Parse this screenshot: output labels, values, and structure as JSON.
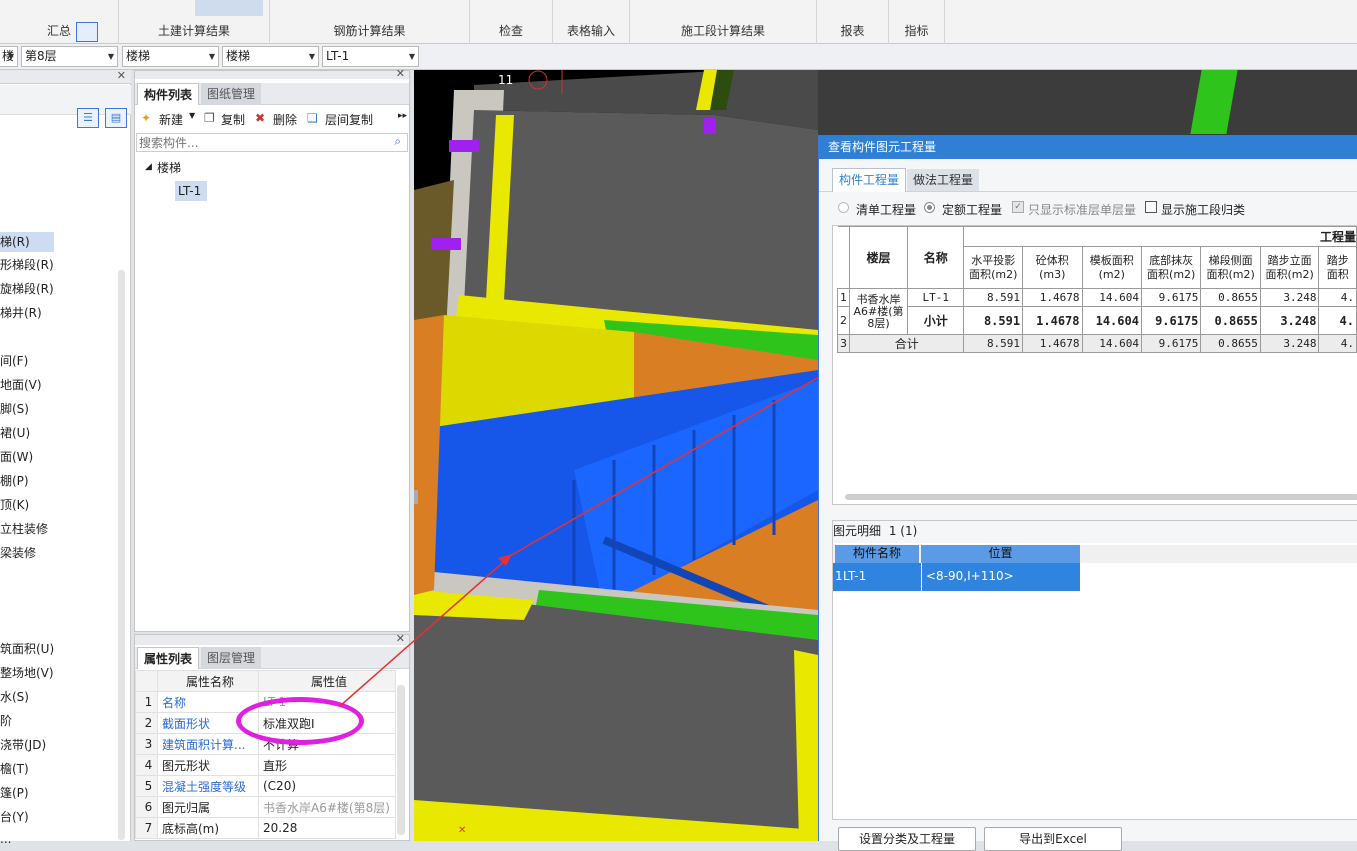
{
  "ribbon": {
    "sections": [
      "汇总",
      "土建计算结果",
      "钢筋计算结果",
      "检查",
      "表格输入",
      "施工段计算结果",
      "报表",
      "指标"
    ]
  },
  "selectors": {
    "building": "楼",
    "floor": "第8层",
    "type": "楼梯",
    "subtype": "楼梯",
    "component": "LT-1"
  },
  "leftnav": {
    "items": [
      "梯(R)",
      "形梯段(R)",
      "旋梯段(R)",
      "梯井(R)",
      "间(F)",
      "地面(V)",
      "脚(S)",
      "裙(U)",
      "面(W)",
      "棚(P)",
      "顶(K)",
      "立柱装修",
      "梁装修",
      "筑面积(U)",
      "整场地(V)",
      "水(S)",
      "阶",
      "浇带(JD)",
      "檐(T)",
      "篷(P)",
      "台(Y)",
      "..."
    ]
  },
  "complist": {
    "tabs": [
      "构件列表",
      "图纸管理"
    ],
    "toolbar": {
      "new": "新建",
      "copy": "复制",
      "delete": "删除",
      "floorcopy": "层间复制"
    },
    "search_placeholder": "搜索构件...",
    "tree_root": "楼梯",
    "tree_child": "LT-1"
  },
  "proplist": {
    "tabs": [
      "属性列表",
      "图层管理"
    ],
    "col_name": "属性名称",
    "col_value": "属性值",
    "rows": [
      {
        "n": "1",
        "name": "名称",
        "value": "LT-1",
        "blue": true
      },
      {
        "n": "2",
        "name": "截面形状",
        "value": "标准双跑I",
        "blue": true
      },
      {
        "n": "3",
        "name": "建筑面积计算...",
        "value": "不计算",
        "blue": true
      },
      {
        "n": "4",
        "name": "图元形状",
        "value": "直形",
        "blue": false
      },
      {
        "n": "5",
        "name": "混凝土强度等级",
        "value": "(C20)",
        "blue": true
      },
      {
        "n": "6",
        "name": "图元归属",
        "value": "书香水岸A6#楼(第8层)",
        "blue": false
      },
      {
        "n": "7",
        "name": "底标高(m)",
        "value": "20.28",
        "blue": false
      }
    ]
  },
  "viewport": {
    "axis_label": "11"
  },
  "dialog": {
    "title": "查看构件图元工程量",
    "tabs": [
      "构件工程量",
      "做法工程量"
    ],
    "options": {
      "list_qty": "清单工程量",
      "quota_qty": "定额工程量",
      "std_floor": "只显示标准层单层量",
      "show_stage": "显示施工段归类"
    },
    "table": {
      "group_header": "工程量",
      "floor_header": "楼层",
      "name_header": "名称",
      "columns": [
        "水平投影面积(m2)",
        "砼体积(m3)",
        "模板面积(m2)",
        "底部抹灰面积(m2)",
        "梯段侧面面积(m2)",
        "踏步立面面积(m2)",
        "踏步面积"
      ],
      "floor_name": "书香水岸A6#楼(第8层)",
      "row1": {
        "n": "1",
        "name": "LT-1",
        "values": [
          "8.591",
          "1.4678",
          "14.604",
          "9.6175",
          "0.8655",
          "3.248",
          "4."
        ]
      },
      "row2": {
        "n": "2",
        "name": "小计",
        "values": [
          "8.591",
          "1.4678",
          "14.604",
          "9.6175",
          "0.8655",
          "3.248",
          "4."
        ]
      },
      "row3": {
        "n": "3",
        "name": "合计",
        "values": [
          "8.591",
          "1.4678",
          "14.604",
          "9.6175",
          "0.8655",
          "3.248",
          "4."
        ]
      }
    },
    "detail": {
      "label": "图元明细",
      "count": "1 (1)",
      "col_component": "构件名称",
      "col_position": "位置",
      "row_n": "1",
      "row_component": "LT-1",
      "row_position": "<8-90,I+110>"
    },
    "buttons": {
      "set_class": "设置分类及工程量",
      "export": "导出到Excel"
    }
  }
}
